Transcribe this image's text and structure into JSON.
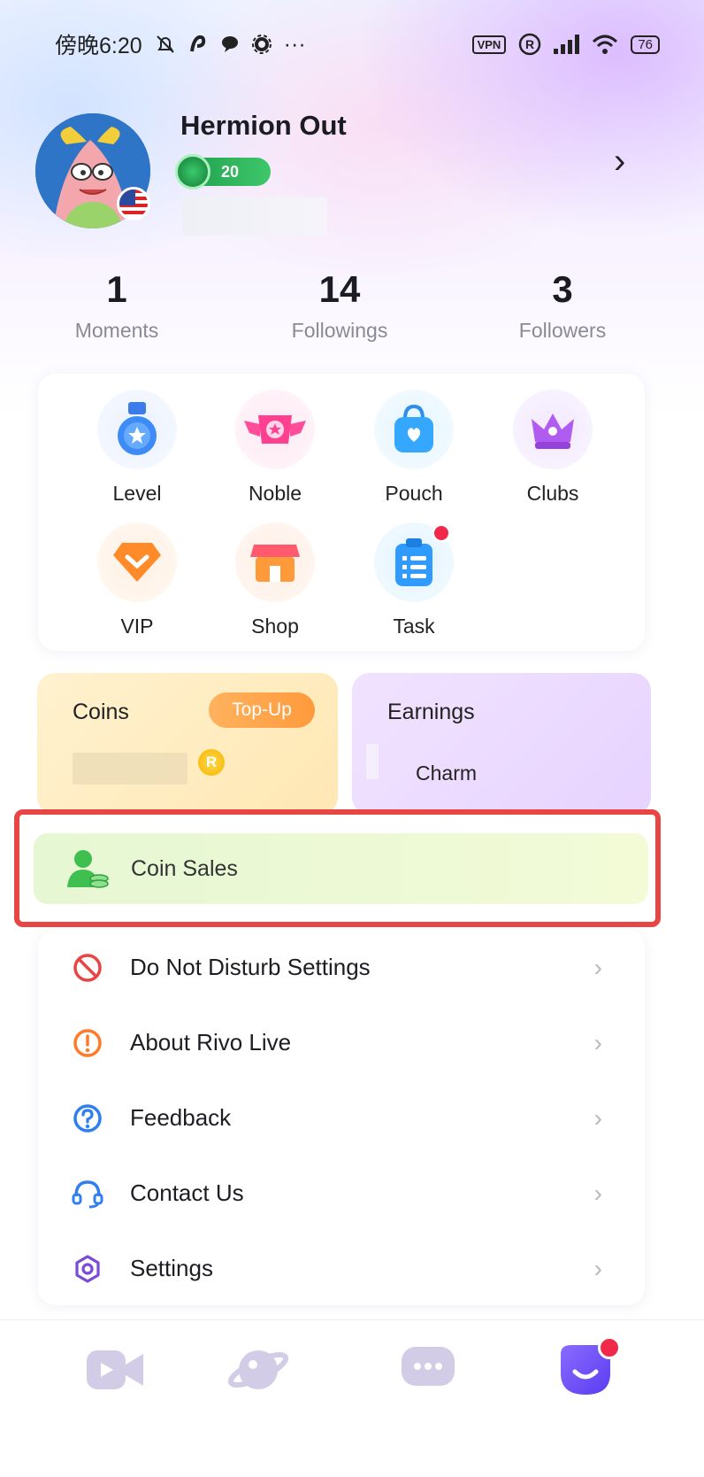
{
  "status_bar": {
    "time": "傍晚6:20",
    "vpn": "VPN",
    "battery": "76"
  },
  "profile": {
    "name": "Hermion Out",
    "level": "20",
    "chevron": "›"
  },
  "stats": [
    {
      "value": "1",
      "label": "Moments"
    },
    {
      "value": "14",
      "label": "Followings"
    },
    {
      "value": "3",
      "label": "Followers"
    }
  ],
  "features": [
    {
      "label": "Level",
      "icon": "medal-icon"
    },
    {
      "label": "Noble",
      "icon": "noble-wings-icon"
    },
    {
      "label": "Pouch",
      "icon": "bag-icon"
    },
    {
      "label": "Clubs",
      "icon": "crown-icon"
    },
    {
      "label": "VIP",
      "icon": "diamond-icon"
    },
    {
      "label": "Shop",
      "icon": "store-icon"
    },
    {
      "label": "Task",
      "icon": "clipboard-icon",
      "badge": true
    }
  ],
  "wallet": {
    "coins_label": "Coins",
    "topup_label": "Top-Up",
    "coin_symbol": "R",
    "earnings_label": "Earnings",
    "charm_label": "Charm"
  },
  "coin_sales": {
    "label": "Coin Sales"
  },
  "menu": [
    {
      "label": "Do Not Disturb Settings",
      "icon": "no-disturb-icon"
    },
    {
      "label": "About Rivo Live",
      "icon": "info-alert-icon"
    },
    {
      "label": "Feedback",
      "icon": "help-icon"
    },
    {
      "label": "Contact Us",
      "icon": "headset-icon"
    },
    {
      "label": "Settings",
      "icon": "gear-icon"
    }
  ],
  "menu_chevron": "›",
  "colors": {
    "accent_red": "#e84545",
    "notification": "#f0294a",
    "nav_active": "#6f4cff"
  },
  "nav": [
    {
      "icon": "live-video-icon"
    },
    {
      "icon": "planet-icon"
    },
    {
      "icon": "chat-icon"
    },
    {
      "icon": "profile-icon",
      "active": true,
      "badge": true
    }
  ]
}
